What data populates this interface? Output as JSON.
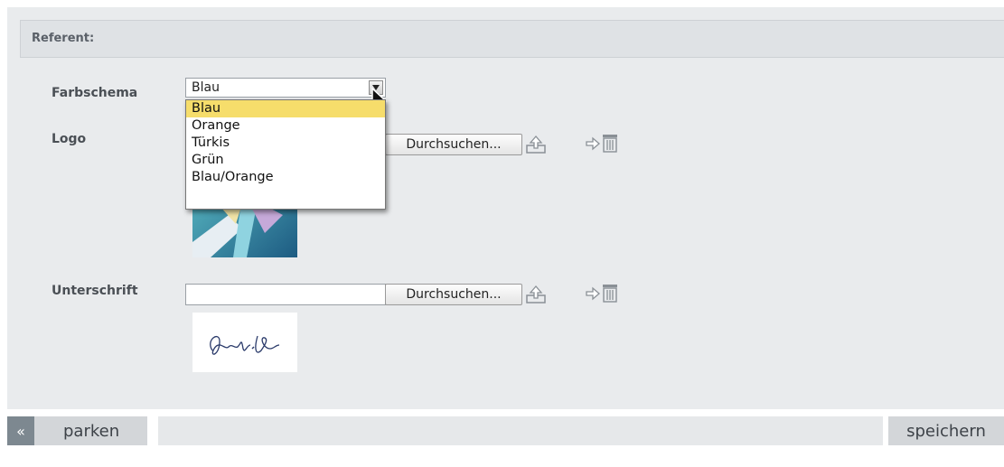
{
  "section": {
    "title": "Referent:"
  },
  "form": {
    "color_scheme": {
      "label": "Farbschema",
      "selected": "Blau",
      "options": [
        "Blau",
        "Orange",
        "Türkis",
        "Grün",
        "Blau/Orange"
      ]
    },
    "logo": {
      "label": "Logo",
      "browse_label": "Durchsuchen..."
    },
    "signature": {
      "label": "Unterschrift",
      "browse_label": "Durchsuchen...",
      "value": ""
    }
  },
  "footer": {
    "back_label": "«",
    "park_label": "parken",
    "save_label": "speichern"
  },
  "colors": {
    "highlight": "#f6dd6b",
    "panel_bg": "#e9ebed",
    "back_button": "#7d8890"
  },
  "icons": [
    "upload-icon",
    "arrow-right-icon",
    "trash-icon",
    "chevron-down-icon",
    "mouse-cursor-icon"
  ]
}
